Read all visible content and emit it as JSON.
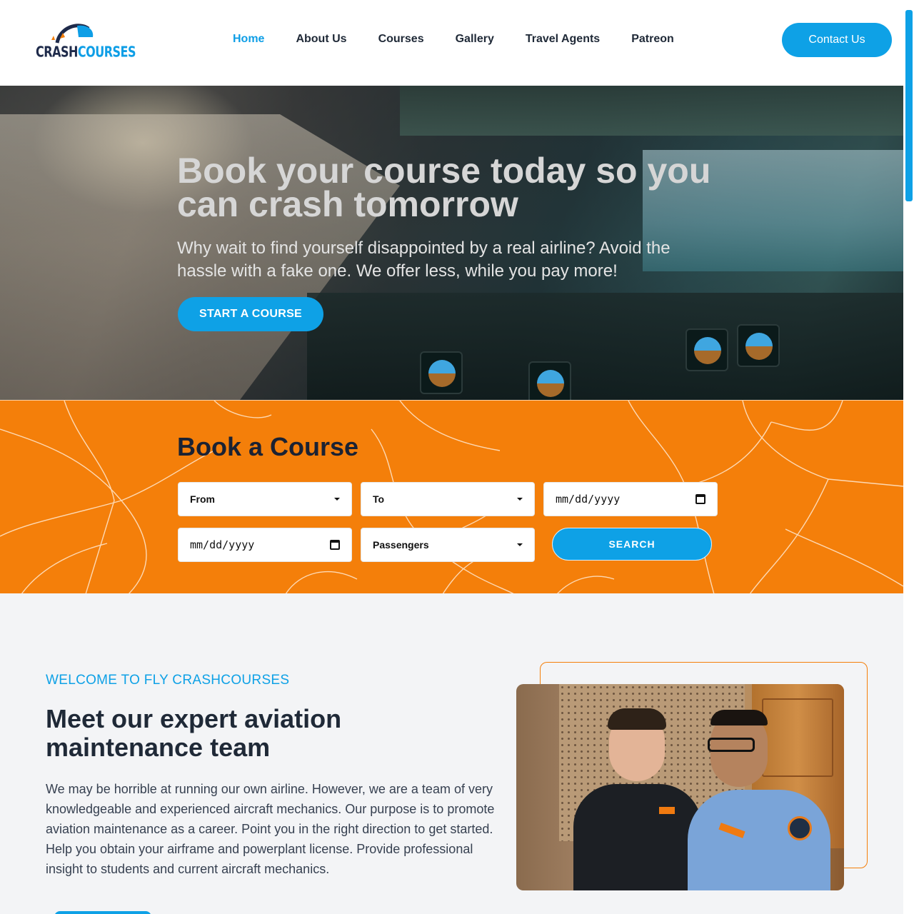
{
  "brand": {
    "logo_text_main": "CRASH",
    "logo_text_accent": "COURSES",
    "accent_color": "#0ea1e6",
    "orange": "#f47f0a"
  },
  "nav": {
    "items": [
      {
        "label": "Home",
        "active": true
      },
      {
        "label": "About Us"
      },
      {
        "label": "Courses"
      },
      {
        "label": "Gallery"
      },
      {
        "label": "Travel Agents"
      },
      {
        "label": "Patreon"
      }
    ],
    "contact_label": "Contact Us"
  },
  "hero": {
    "title": "Book your course today so you can crash tomorrow",
    "subtitle": "Why wait to find yourself disappointed by a real airline? Avoid the hassle with a fake one. We offer less, while you pay more!",
    "cta_label": "START A COURSE"
  },
  "booking": {
    "title": "Book a Course",
    "from_label": "From",
    "to_label": "To",
    "date1_value": "mm/dd/yyyy",
    "date2_value": "mm/dd/yyyy",
    "passengers_label": "Passengers",
    "search_label": "SEARCH"
  },
  "welcome": {
    "kicker": "WELCOME TO FLY CRASHCOURSES",
    "title": "Meet our expert aviation maintenance team",
    "body": "We may be horrible at running our own airline. However, we are a team of very knowledgeable and experienced aircraft mechanics. Our purpose is to promote aviation maintenance as a career. Point you in the right direction to get started. Help you obtain your airframe and powerplant license. Provide professional insight to students and current aircraft mechanics."
  }
}
